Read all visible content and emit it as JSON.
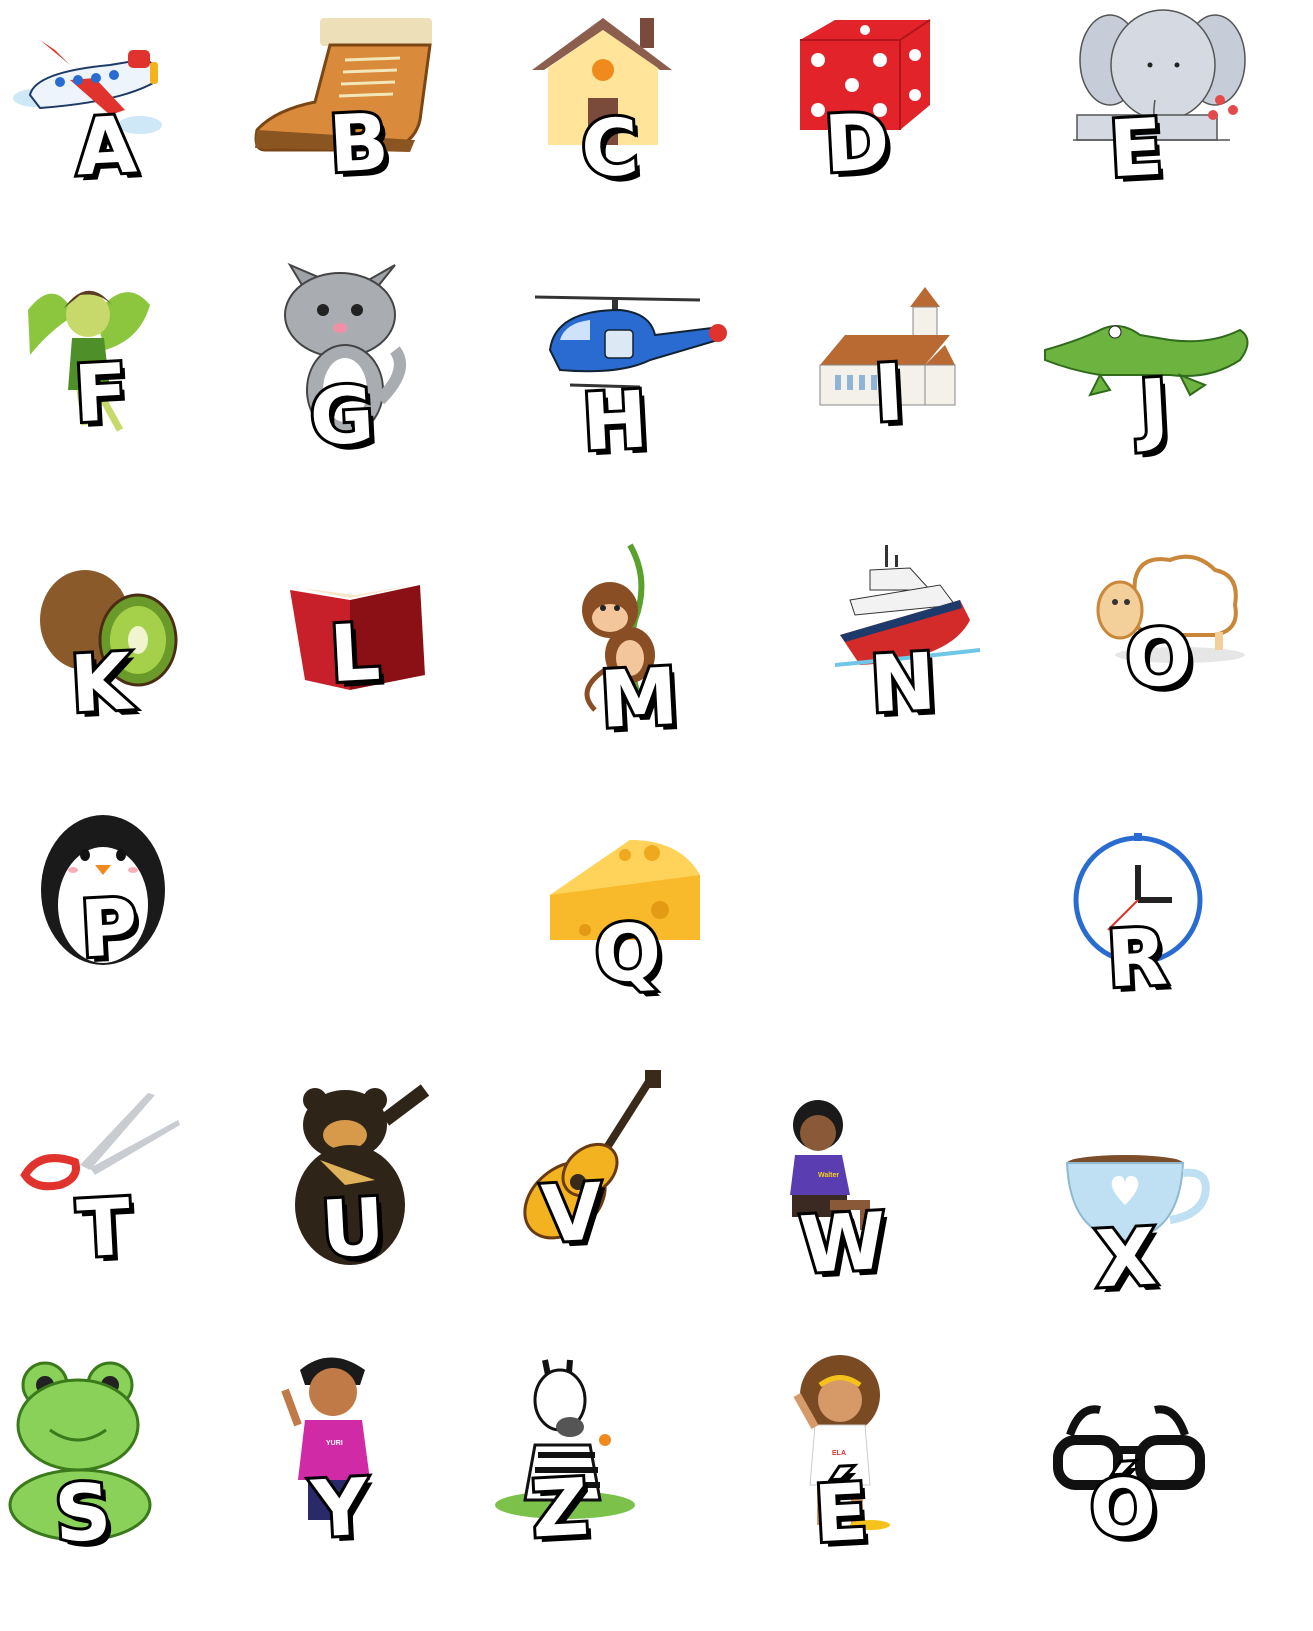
{
  "sheet": {
    "letters": [
      "A",
      "B",
      "C",
      "D",
      "E",
      "F",
      "G",
      "H",
      "I",
      "J",
      "K",
      "L",
      "M",
      "N",
      "O",
      "P",
      "Q",
      "R",
      "T",
      "U",
      "V",
      "W",
      "X",
      "S",
      "Y",
      "Z",
      "É",
      "Ó"
    ],
    "shirt_labels": {
      "w": "Walter",
      "y": "YURI",
      "e": "ELA"
    }
  }
}
